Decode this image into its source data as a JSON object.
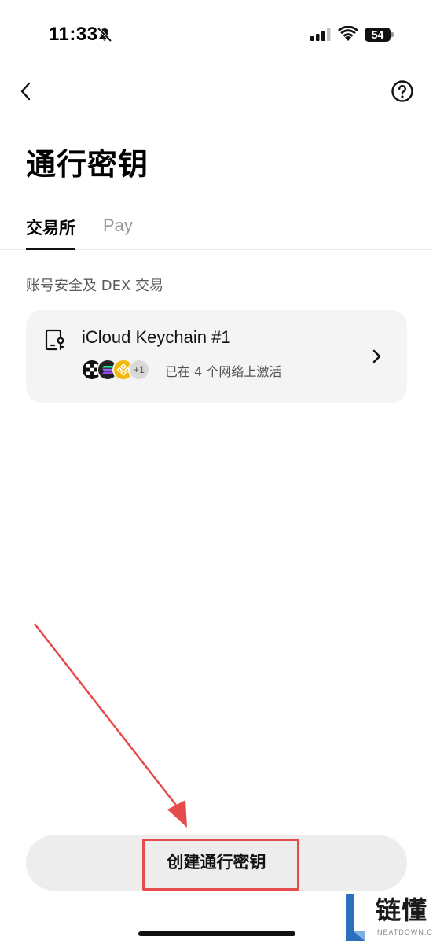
{
  "status_bar": {
    "time": "11:33",
    "battery": "54",
    "icons": [
      "bell-slash-icon",
      "signal-icon",
      "wifi-icon",
      "battery-icon"
    ]
  },
  "nav": {
    "back_icon": "chevron-left-icon",
    "help_icon": "question-circle-icon"
  },
  "page": {
    "title": "通行密钥"
  },
  "tabs": [
    {
      "label": "交易所",
      "active": true
    },
    {
      "label": "Pay",
      "active": false
    }
  ],
  "section": {
    "label": "账号安全及 DEX 交易"
  },
  "passkey": {
    "icon": "passkey-device-icon",
    "name": "iCloud Keychain #1",
    "chains": [
      "okx-icon",
      "solana-icon",
      "bnb-icon"
    ],
    "more_count": "+1",
    "status": "已在 4 个网络上激活"
  },
  "actions": {
    "create_label": "创建通行密钥"
  },
  "colors": {
    "annotation": "#e64a4a",
    "button_bg": "#ededed",
    "card_bg": "#f4f4f4"
  },
  "watermark": {
    "text": "链懂",
    "sub": "NEATDOWN.COM"
  }
}
